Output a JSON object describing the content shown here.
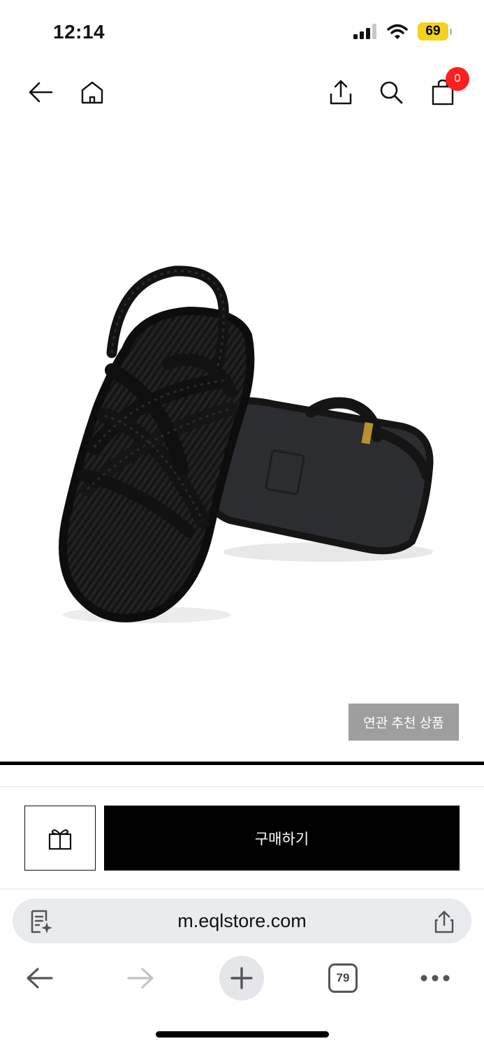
{
  "status_bar": {
    "time": "12:14",
    "battery": "69",
    "battery_color": "#f4d21f",
    "icons": [
      "signal-icon",
      "wifi-icon",
      "battery-icon"
    ]
  },
  "top_nav": {
    "icons": [
      "back-arrow-icon",
      "home-icon",
      "share-icon",
      "search-icon",
      "shopping-bag-icon"
    ],
    "cart_count": "0",
    "badge_color": "#ff1f1f"
  },
  "product": {
    "image": "black-rope-sandal-image"
  },
  "related_button": "연관 추천 상품",
  "purchase_bar": {
    "gift_icon": "gift-icon",
    "buy_label": "구매하기"
  },
  "browser": {
    "url": "m.eqlstore.com",
    "tab_count": "79",
    "icons": [
      "page-summary-icon",
      "share-icon",
      "back-arrow-icon",
      "forward-arrow-icon",
      "plus-icon",
      "tabs-icon",
      "more-icon"
    ]
  }
}
